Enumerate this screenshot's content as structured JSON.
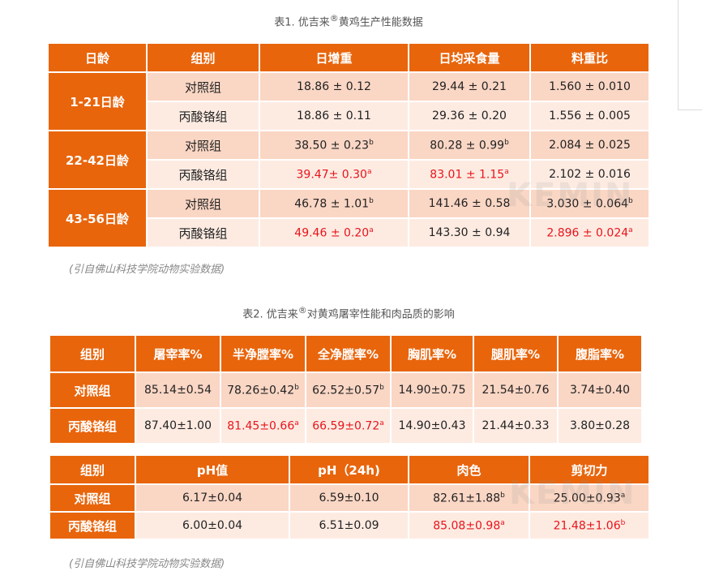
{
  "table1": {
    "caption_prefix": "表1. 优吉来",
    "caption_mark": "®",
    "caption_suffix": "黄鸡生产性能数据",
    "headers": [
      "日龄",
      "组别",
      "日增重",
      "日均采食量",
      "料重比"
    ],
    "groups": [
      {
        "age": "1-21日龄",
        "rows": [
          {
            "group": "对照组",
            "cells": [
              {
                "v": "18.86 ± 0.12",
                "sup": "",
                "red": false
              },
              {
                "v": "29.44 ± 0.21",
                "sup": "",
                "red": false
              },
              {
                "v": "1.560 ± 0.010",
                "sup": "",
                "red": false
              }
            ]
          },
          {
            "group": "丙酸铬组",
            "cells": [
              {
                "v": "18.86 ± 0.11",
                "sup": "",
                "red": false
              },
              {
                "v": "29.36 ± 0.20",
                "sup": "",
                "red": false
              },
              {
                "v": "1.556 ± 0.005",
                "sup": "",
                "red": false
              }
            ]
          }
        ]
      },
      {
        "age": "22-42日龄",
        "rows": [
          {
            "group": "对照组",
            "cells": [
              {
                "v": "38.50 ± 0.23",
                "sup": "b",
                "red": false
              },
              {
                "v": "80.28 ± 0.99",
                "sup": "b",
                "red": false
              },
              {
                "v": "2.084 ± 0.025",
                "sup": "",
                "red": false
              }
            ]
          },
          {
            "group": "丙酸铬组",
            "cells": [
              {
                "v": "39.47± 0.30",
                "sup": "a",
                "red": true
              },
              {
                "v": "83.01 ± 1.15",
                "sup": "a",
                "red": true
              },
              {
                "v": "2.102 ± 0.016",
                "sup": "",
                "red": false
              }
            ]
          }
        ]
      },
      {
        "age": "43-56日龄",
        "rows": [
          {
            "group": "对照组",
            "cells": [
              {
                "v": "46.78 ± 1.01",
                "sup": "b",
                "red": false
              },
              {
                "v": "141.46 ± 0.58",
                "sup": "",
                "red": false
              },
              {
                "v": "3.030 ± 0.064",
                "sup": "b",
                "red": false
              }
            ]
          },
          {
            "group": "丙酸铬组",
            "cells": [
              {
                "v": "49.46 ± 0.20",
                "sup": "a",
                "red": true
              },
              {
                "v": "143.30 ± 0.94",
                "sup": "",
                "red": false
              },
              {
                "v": "2.896 ± 0.024",
                "sup": "a",
                "red": true
              }
            ]
          }
        ]
      }
    ],
    "source": "(引自佛山科技学院动物实验数据)"
  },
  "table2": {
    "caption_prefix": "表2. 优吉来",
    "caption_mark": "®",
    "caption_suffix": "对黄鸡屠宰性能和肉品质的影响",
    "part1": {
      "headers": [
        "组别",
        "屠宰率%",
        "半净膛率%",
        "全净膛率%",
        "胸肌率%",
        "腿肌率%",
        "腹脂率%"
      ],
      "rows": [
        {
          "group": "对照组",
          "cells": [
            {
              "v": "85.14±0.54",
              "sup": "",
              "red": false
            },
            {
              "v": "78.26±0.42",
              "sup": "b",
              "red": false
            },
            {
              "v": "62.52±0.57",
              "sup": "b",
              "red": false
            },
            {
              "v": "14.90±0.75",
              "sup": "",
              "red": false
            },
            {
              "v": "21.54±0.76",
              "sup": "",
              "red": false
            },
            {
              "v": "3.74±0.40",
              "sup": "",
              "red": false
            }
          ]
        },
        {
          "group": "丙酸铬组",
          "cells": [
            {
              "v": "87.40±1.00",
              "sup": "",
              "red": false
            },
            {
              "v": "81.45±0.66",
              "sup": "a",
              "red": true
            },
            {
              "v": "66.59±0.72",
              "sup": "a",
              "red": true
            },
            {
              "v": "14.90±0.43",
              "sup": "",
              "red": false
            },
            {
              "v": "21.44±0.33",
              "sup": "",
              "red": false
            },
            {
              "v": "3.80±0.28",
              "sup": "",
              "red": false
            }
          ]
        }
      ]
    },
    "part2": {
      "headers": [
        "组别",
        "pH值",
        "pH（24h)",
        "肉色",
        "剪切力"
      ],
      "rows": [
        {
          "group": "对照组",
          "cells": [
            {
              "v": "6.17±0.04",
              "sup": "",
              "red": false
            },
            {
              "v": "6.59±0.10",
              "sup": "",
              "red": false
            },
            {
              "v": "82.61±1.88",
              "sup": "b",
              "red": false
            },
            {
              "v": "25.00±0.93",
              "sup": "a",
              "red": false
            }
          ]
        },
        {
          "group": "丙酸铬组",
          "cells": [
            {
              "v": "6.00±0.04",
              "sup": "",
              "red": false
            },
            {
              "v": "6.51±0.09",
              "sup": "",
              "red": false
            },
            {
              "v": "85.08±0.98",
              "sup": "a",
              "red": true
            },
            {
              "v": "21.48±1.06",
              "sup": "b",
              "red": true
            }
          ]
        }
      ]
    },
    "source": "(引自佛山科技学院动物实验数据)"
  },
  "watermark": "KEMIN",
  "colors": {
    "header": "#e8650c",
    "row_dark": "#fad6c4",
    "row_light": "#fdebe2",
    "red": "#e8141b"
  }
}
